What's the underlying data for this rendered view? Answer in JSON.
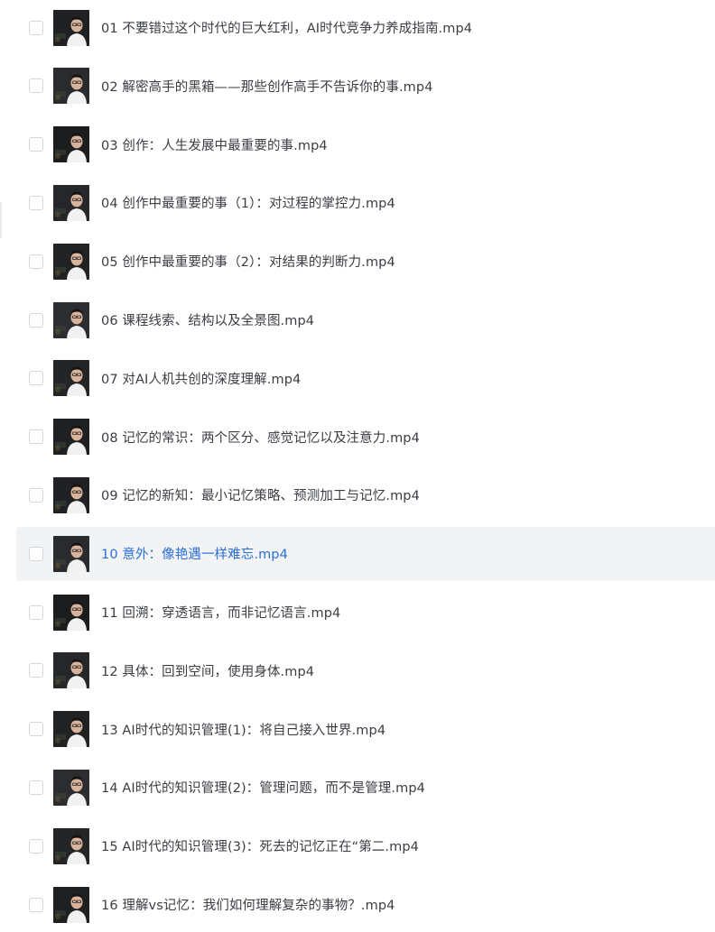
{
  "files": [
    {
      "name": "01 不要错过这个时代的巨大红利，AI时代竞争力养成指南.mp4",
      "selected": false
    },
    {
      "name": "02 解密高手的黑箱——那些创作高手不告诉你的事.mp4",
      "selected": false
    },
    {
      "name": "03 创作：人生发展中最重要的事.mp4",
      "selected": false
    },
    {
      "name": "04 创作中最重要的事（1）：对过程的掌控力.mp4",
      "selected": false
    },
    {
      "name": "05 创作中最重要的事（2）：对结果的判断力.mp4",
      "selected": false
    },
    {
      "name": "06 课程线索、结构以及全景图.mp4",
      "selected": false
    },
    {
      "name": "07 对AI人机共创的深度理解.mp4",
      "selected": false
    },
    {
      "name": "08 记忆的常识：两个区分、感觉记忆以及注意力.mp4",
      "selected": false
    },
    {
      "name": "09 记忆的新知：最小记忆策略、预测加工与记忆.mp4",
      "selected": false
    },
    {
      "name": "10 意外：像艳遇一样难忘.mp4",
      "selected": true
    },
    {
      "name": "11 回溯：穿透语言，而非记忆语言.mp4",
      "selected": false
    },
    {
      "name": "12 具体：回到空间，使用身体.mp4",
      "selected": false
    },
    {
      "name": "13 AI时代的知识管理(1)：将自己接入世界.mp4",
      "selected": false
    },
    {
      "name": "14 AI时代的知识管理(2)：管理问题，而不是管理.mp4",
      "selected": false
    },
    {
      "name": "15 AI时代的知识管理(3)：死去的记忆正在“第二.mp4",
      "selected": false
    },
    {
      "name": "16 理解vs记忆：我们如何理解复杂的事物？.mp4",
      "selected": false
    }
  ],
  "colors": {
    "text": "#3a3d42",
    "selected_text": "#2b6fd6",
    "selected_bg": "#f2f3f5",
    "checkbox_border": "#d3d6db"
  },
  "icons": {
    "thumbnail": "video-thumbnail-icon",
    "checkbox": "checkbox-icon"
  }
}
